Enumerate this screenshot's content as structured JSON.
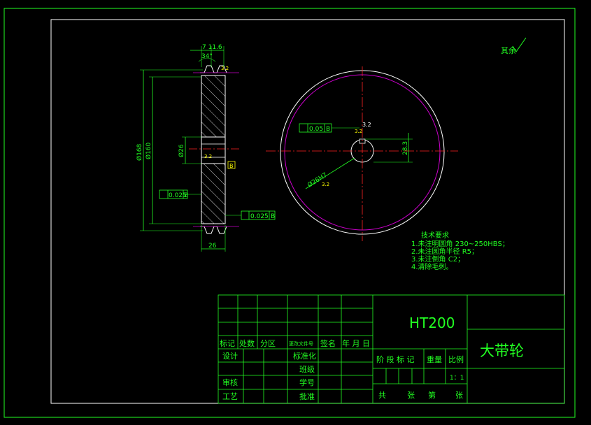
{
  "colors": {
    "background": "#000000",
    "frame": "#ffffff",
    "geometry": "#22ff22",
    "centerline": "#ff2222",
    "outline": "#ffffff",
    "groove_circle": "#cc00cc",
    "annotation": "#ffff00"
  },
  "surface_finish": {
    "label": "其余",
    "icon": "surface-roughness-check-icon"
  },
  "section_view": {
    "dim_top": "7 11.6",
    "dim_angle": "34°",
    "dim_outer_dia": "Ø168",
    "dim_pitch_dia": "Ø160",
    "dim_bore": "Ø26",
    "dim_width": "26",
    "runout_left": "0.025",
    "runout_left_ref": "B",
    "runout_right": "0.025",
    "runout_right_ref": "B",
    "datum_label": "B",
    "roughness_hub": "3.2",
    "roughness_groove": "3.2"
  },
  "front_view": {
    "keyway_tolerance": "0.05",
    "keyway_tolerance_ref": "B",
    "keyway_depth": "28.3",
    "bore_fit": "Ø26H7",
    "roughness_keyway": "3.2",
    "roughness_bore": "3.2"
  },
  "tech_requirements": {
    "title": "技术要求",
    "items": [
      "1.未注明圆角 230~250HBS；",
      "2.未注圆角半径 R5；",
      "3.未注倒角 C2；",
      "4.清除毛刺。"
    ]
  },
  "title_block": {
    "material": "HT200",
    "part_name": "大带轮",
    "row_labels": [
      "标记",
      "处数",
      "分区",
      "更改文件号",
      "签名",
      "年 月 日"
    ],
    "design": "设计",
    "standardize": "标准化",
    "review": "审核",
    "process": "工艺",
    "class": "班级",
    "student_id": "学号",
    "approve": "批准",
    "stage_mark": "阶 段 标 记",
    "weight": "重量",
    "scale_label": "比例",
    "scale_value": "1：1",
    "total": "共",
    "sheets": "张",
    "number": "第",
    "sheet": "张"
  }
}
